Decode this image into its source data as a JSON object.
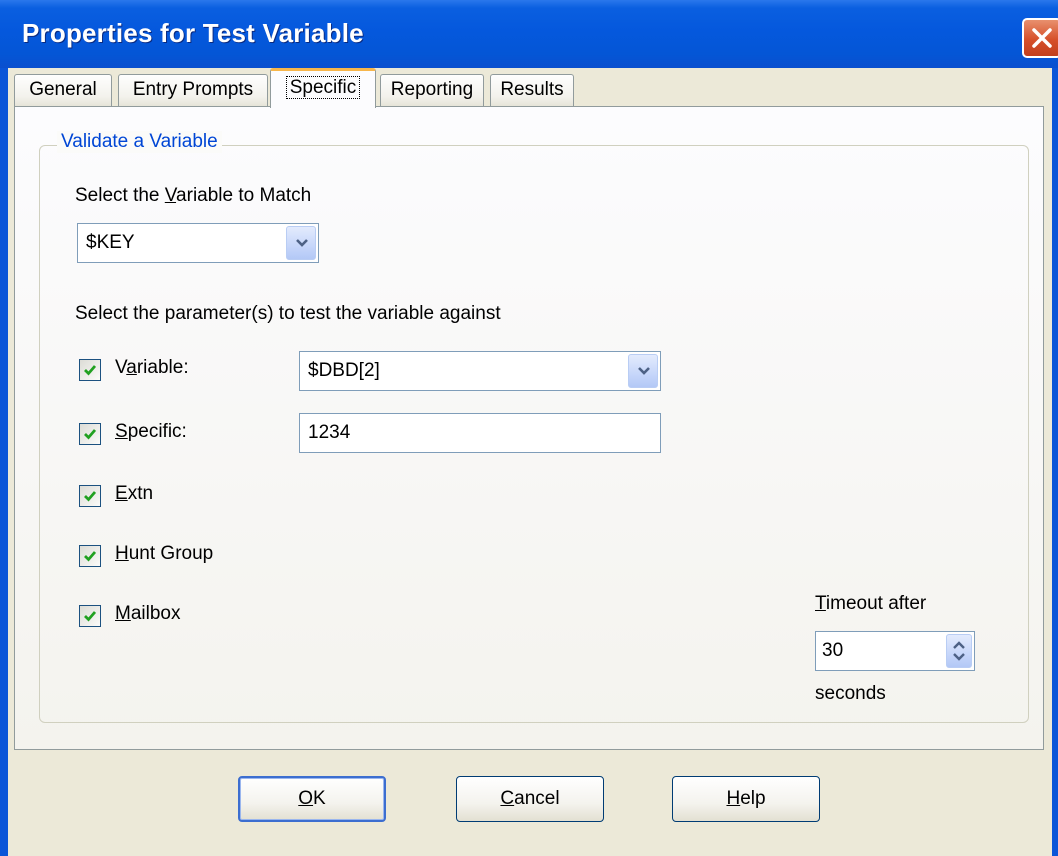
{
  "window": {
    "title": "Properties for Test Variable"
  },
  "tabs": [
    {
      "label": "General",
      "active": false
    },
    {
      "label": "Entry Prompts",
      "active": false
    },
    {
      "label": "Specific",
      "active": true
    },
    {
      "label": "Reporting",
      "active": false
    },
    {
      "label": "Results",
      "active": false
    }
  ],
  "group": {
    "title": "Validate a Variable",
    "match_label_pre": "Select the ",
    "match_label_u": "V",
    "match_label_post": "ariable to Match",
    "match_value": "$KEY",
    "params_label": "Select the parameter(s) to test the variable against"
  },
  "params": {
    "variable": {
      "pre": "V",
      "u": "a",
      "post": "riable:",
      "checked": true,
      "value": "$DBD[2]"
    },
    "specific": {
      "pre": "",
      "u": "S",
      "post": "pecific:",
      "checked": true,
      "value": "1234"
    },
    "extn": {
      "pre": "",
      "u": "E",
      "post": "xtn",
      "checked": true
    },
    "hunt_group": {
      "pre": "",
      "u": "H",
      "post": "unt Group",
      "checked": true
    },
    "mailbox": {
      "pre": "",
      "u": "M",
      "post": "ailbox",
      "checked": true
    }
  },
  "timeout": {
    "label_u": "T",
    "label_post": "imeout after",
    "value": "30",
    "unit": "seconds"
  },
  "buttons": {
    "ok_u": "O",
    "ok_post": "K",
    "cancel_u": "C",
    "cancel_post": "ancel",
    "help_u": "H",
    "help_post": "elp"
  },
  "colors": {
    "title_bar": "#0558dd",
    "group_title": "#0046d5",
    "tab_highlight": "#f7b64b"
  }
}
